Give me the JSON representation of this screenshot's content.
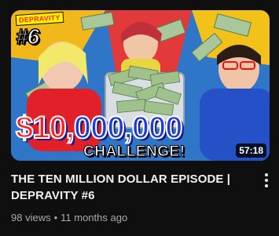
{
  "video": {
    "title_line1": "THE TEN MILLION DOLLAR EPISODE |",
    "title_line2": "DEPRAVITY #6",
    "views": "98 views",
    "separator": "•",
    "age": "11 months ago",
    "duration": "57:18"
  },
  "thumbnail": {
    "channel_logo": "DEPRAVITY",
    "episode": "#6",
    "amount_red": "$10,",
    "amount_blue": "000,000",
    "challenge": "CHALLENGE!"
  },
  "icons": {
    "more": "more-vertical-icon"
  },
  "colors": {
    "background": "#0f0f0f",
    "title": "#f1f1f1",
    "meta": "#aaaaaa"
  }
}
